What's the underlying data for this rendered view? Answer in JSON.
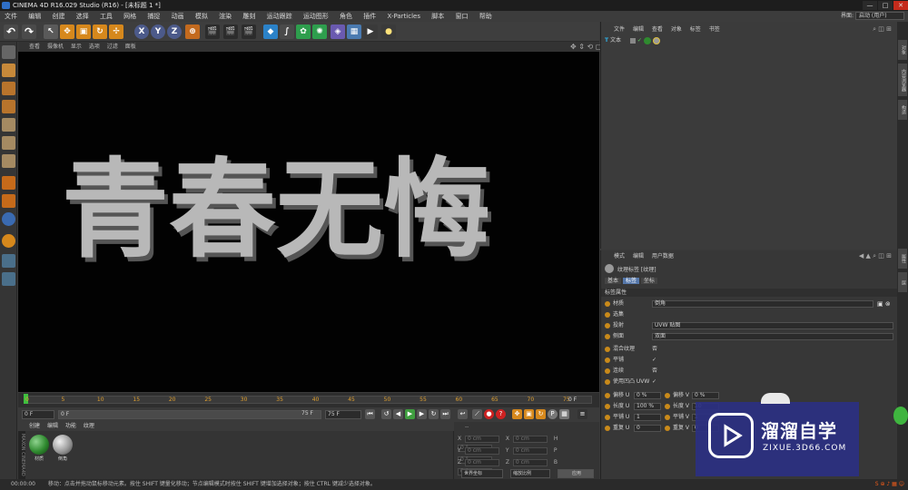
{
  "window": {
    "title": "CINEMA 4D R16.029 Studio (R16) - [未标题 1 *]",
    "min": "—",
    "max": "□",
    "close": "✕"
  },
  "menubar": [
    "文件",
    "编辑",
    "创建",
    "选择",
    "工具",
    "网格",
    "捕捉",
    "动画",
    "模拟",
    "渲染",
    "雕刻",
    "运动跟踪",
    "运动图形",
    "角色",
    "插件",
    "X-Particles",
    "脚本",
    "窗口",
    "帮助"
  ],
  "layout": {
    "label": "界面:",
    "value": "启动 (用户)"
  },
  "toolbar": {
    "axis_x": "X",
    "axis_y": "Y",
    "axis_z": "Z"
  },
  "viewport": {
    "menu": [
      "查看",
      "摄像机",
      "显示",
      "选项",
      "过滤",
      "面板"
    ],
    "text3d": "青春无悔",
    "text_color": "#b8b8b8"
  },
  "timeline": {
    "ticks": [
      "0",
      "5",
      "10",
      "15",
      "20",
      "25",
      "30",
      "35",
      "40",
      "45",
      "50",
      "55",
      "60",
      "65",
      "70",
      "75"
    ],
    "end_label": "0 F"
  },
  "transport": {
    "start": "0 F",
    "current": "0 F",
    "end1": "75 F",
    "end2": "75 F"
  },
  "materials": {
    "menu": [
      "创建",
      "编辑",
      "功能",
      "纹理"
    ],
    "items": [
      {
        "name": "材质",
        "color": "#2f8a2f"
      },
      {
        "name": "倒角",
        "color": "#9a9a9a"
      }
    ]
  },
  "coords": {
    "header": "--",
    "rows": [
      {
        "a": "X",
        "av": "0 cm",
        "b": "X",
        "bv": "0 cm",
        "c": "H",
        "cv": "0 °"
      },
      {
        "a": "Y",
        "av": "0 cm",
        "b": "Y",
        "bv": "0 cm",
        "c": "P",
        "cv": "0 °"
      },
      {
        "a": "Z",
        "av": "0 cm",
        "b": "Z",
        "bv": "0 cm",
        "c": "B",
        "cv": "0 °"
      }
    ],
    "mode1": "世界坐标",
    "mode2": "缩放比例",
    "apply": "应用"
  },
  "status": {
    "time": "00:00:00",
    "hint": "移动：点击并拖动鼠标移动元素。按住 SHIFT 键量化移动；节点编辑模式时按住 SHIFT 键增加选择对象；按住 CTRL 键减少选择对象。"
  },
  "object_manager": {
    "menu": [
      "文件",
      "编辑",
      "查看",
      "对象",
      "标签",
      "书签"
    ],
    "object": {
      "name": "文本"
    }
  },
  "attribute_manager": {
    "menu": [
      "模式",
      "编辑",
      "用户数据"
    ],
    "title": "纹理标签 [纹理]",
    "tabs": [
      "基本",
      "标签",
      "坐标"
    ],
    "section": "标签属性",
    "rows": [
      {
        "label": "材质",
        "value": "倒角"
      },
      {
        "label": "选集",
        "value": ""
      },
      {
        "label": "投射",
        "value": "UVW 贴图"
      },
      {
        "label": "侧面",
        "value": "双面"
      },
      {
        "label": "混合纹理",
        "value": "否"
      },
      {
        "label": "平铺",
        "value": "✓"
      },
      {
        "label": "连续",
        "value": "否"
      },
      {
        "label": "使用凹凸 UVW",
        "value": "✓"
      }
    ],
    "grid": [
      {
        "l1": "偏移 U",
        "v1": "0 %",
        "l2": "偏移 V",
        "v2": "0 %"
      },
      {
        "l1": "长度 U",
        "v1": "100 %",
        "l2": "长度 V",
        "v2": "10"
      },
      {
        "l1": "平铺 U",
        "v1": "1",
        "l2": "平铺 V",
        "v2": "1"
      },
      {
        "l1": "重复 U",
        "v1": "0",
        "l2": "重复 V",
        "v2": "0"
      }
    ]
  },
  "right_strip": [
    "对象",
    "内容浏览器",
    "构造",
    "属性",
    "层"
  ],
  "watermark": {
    "title": "溜溜自学",
    "url": "ZIXUE.3D66.COM"
  }
}
